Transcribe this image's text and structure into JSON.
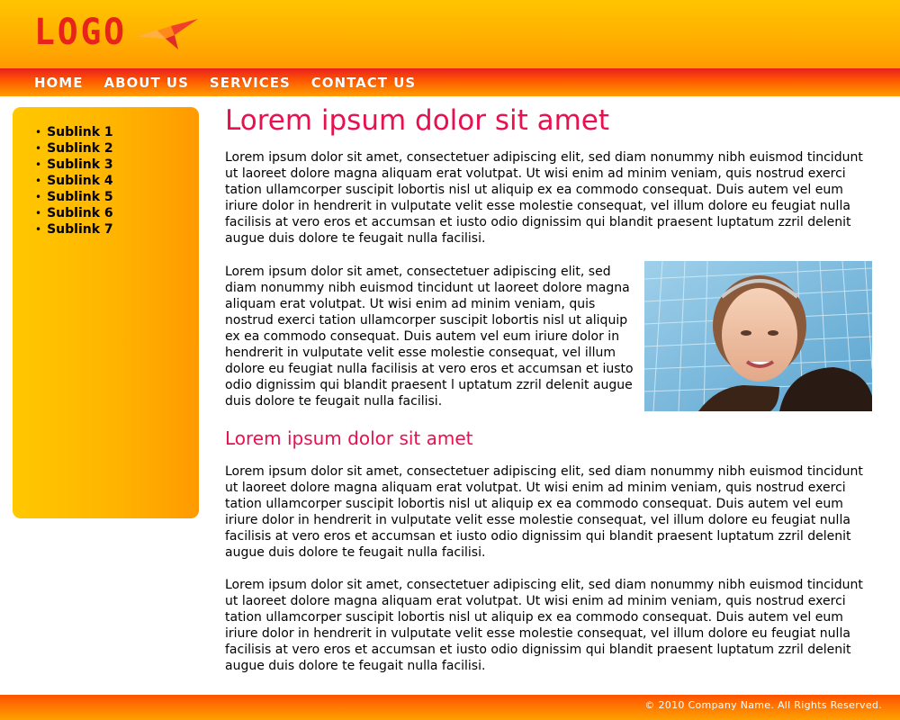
{
  "header": {
    "logo_text": "LOGO",
    "logo_icon": "paper-plane-star-icon"
  },
  "nav": {
    "items": [
      {
        "label": "HOME"
      },
      {
        "label": "ABOUT US"
      },
      {
        "label": "SERVICES"
      },
      {
        "label": "CONTACT US"
      }
    ]
  },
  "sidebar": {
    "bullet": "•",
    "items": [
      {
        "label": "Sublink 1"
      },
      {
        "label": "Sublink 2"
      },
      {
        "label": "Sublink 3"
      },
      {
        "label": "Sublink 4"
      },
      {
        "label": "Sublink 5"
      },
      {
        "label": "Sublink 6"
      },
      {
        "label": "Sublink 7"
      }
    ]
  },
  "main": {
    "title": "Lorem ipsum dolor sit amet",
    "paragraphs": [
      "Lorem ipsum dolor sit amet, consectetuer adipiscing elit, sed diam nonummy nibh euismod tincidunt ut laoreet dolore magna aliquam erat volutpat. Ut wisi enim ad minim veniam, quis nostrud exerci tation ullamcorper suscipit lobortis nisl ut aliquip ex ea commodo consequat. Duis autem vel eum iriure dolor in hendrerit in vulputate velit esse molestie consequat, vel illum dolore eu feugiat nulla facilisis at vero eros et accumsan et iusto odio dignissim qui blandit praesent luptatum zzril delenit augue duis dolore te feugait nulla facilisi.",
      "Lorem ipsum dolor sit amet, consectetuer adipiscing elit, sed diam nonummy nibh euismod tincidunt ut laoreet dolore magna aliquam erat volutpat. Ut wisi enim ad minim veniam, quis nostrud exerci tation ullamcorper suscipit lobortis nisl ut aliquip ex ea commodo consequat. Duis autem vel eum iriure dolor in hendrerit in vulputate velit esse molestie consequat, vel illum dolore eu feugiat nulla facilisis at vero eros et accumsan et iusto odio dignissim qui blandit praesent l uptatum zzril delenit augue duis dolore te feugait nulla facilisi.",
      "Lorem ipsum dolor sit amet, consectetuer adipiscing elit, sed diam nonummy nibh euismod tincidunt ut laoreet dolore magna aliquam erat volutpat. Ut wisi enim ad minim veniam, quis nostrud exerci tation ullamcorper suscipit lobortis nisl ut aliquip ex ea commodo consequat. Duis autem vel eum iriure dolor in hendrerit in vulputate velit esse molestie consequat, vel illum dolore eu feugiat nulla facilisis at vero eros et accumsan et iusto odio dignissim qui blandit praesent luptatum zzril delenit augue duis dolore te feugait nulla facilisi.",
      "Lorem ipsum dolor sit amet, consectetuer adipiscing elit, sed diam nonummy nibh euismod tincidunt ut laoreet dolore magna aliquam erat volutpat. Ut wisi enim ad minim veniam, quis nostrud exerci tation ullamcorper suscipit lobortis nisl ut aliquip ex ea commodo consequat. Duis autem vel eum iriure dolor in hendrerit in vulputate velit esse molestie consequat, vel illum dolore eu feugiat nulla facilisis at vero eros et accumsan et iusto odio dignissim qui blandit praesent luptatum zzril delenit augue duis dolore te feugait nulla facilisi."
    ],
    "subtitle": "Lorem ipsum dolor sit amet",
    "photo_icon": "woman-portrait-photo"
  },
  "footer": {
    "copyright": "© 2010 Company Name. All Rights Reserved."
  },
  "colors": {
    "accent": "#e8104f",
    "logo": "#e8231a",
    "header": "#ffb000",
    "nav": "#ff5a00",
    "sidebar": "#ffb400"
  }
}
